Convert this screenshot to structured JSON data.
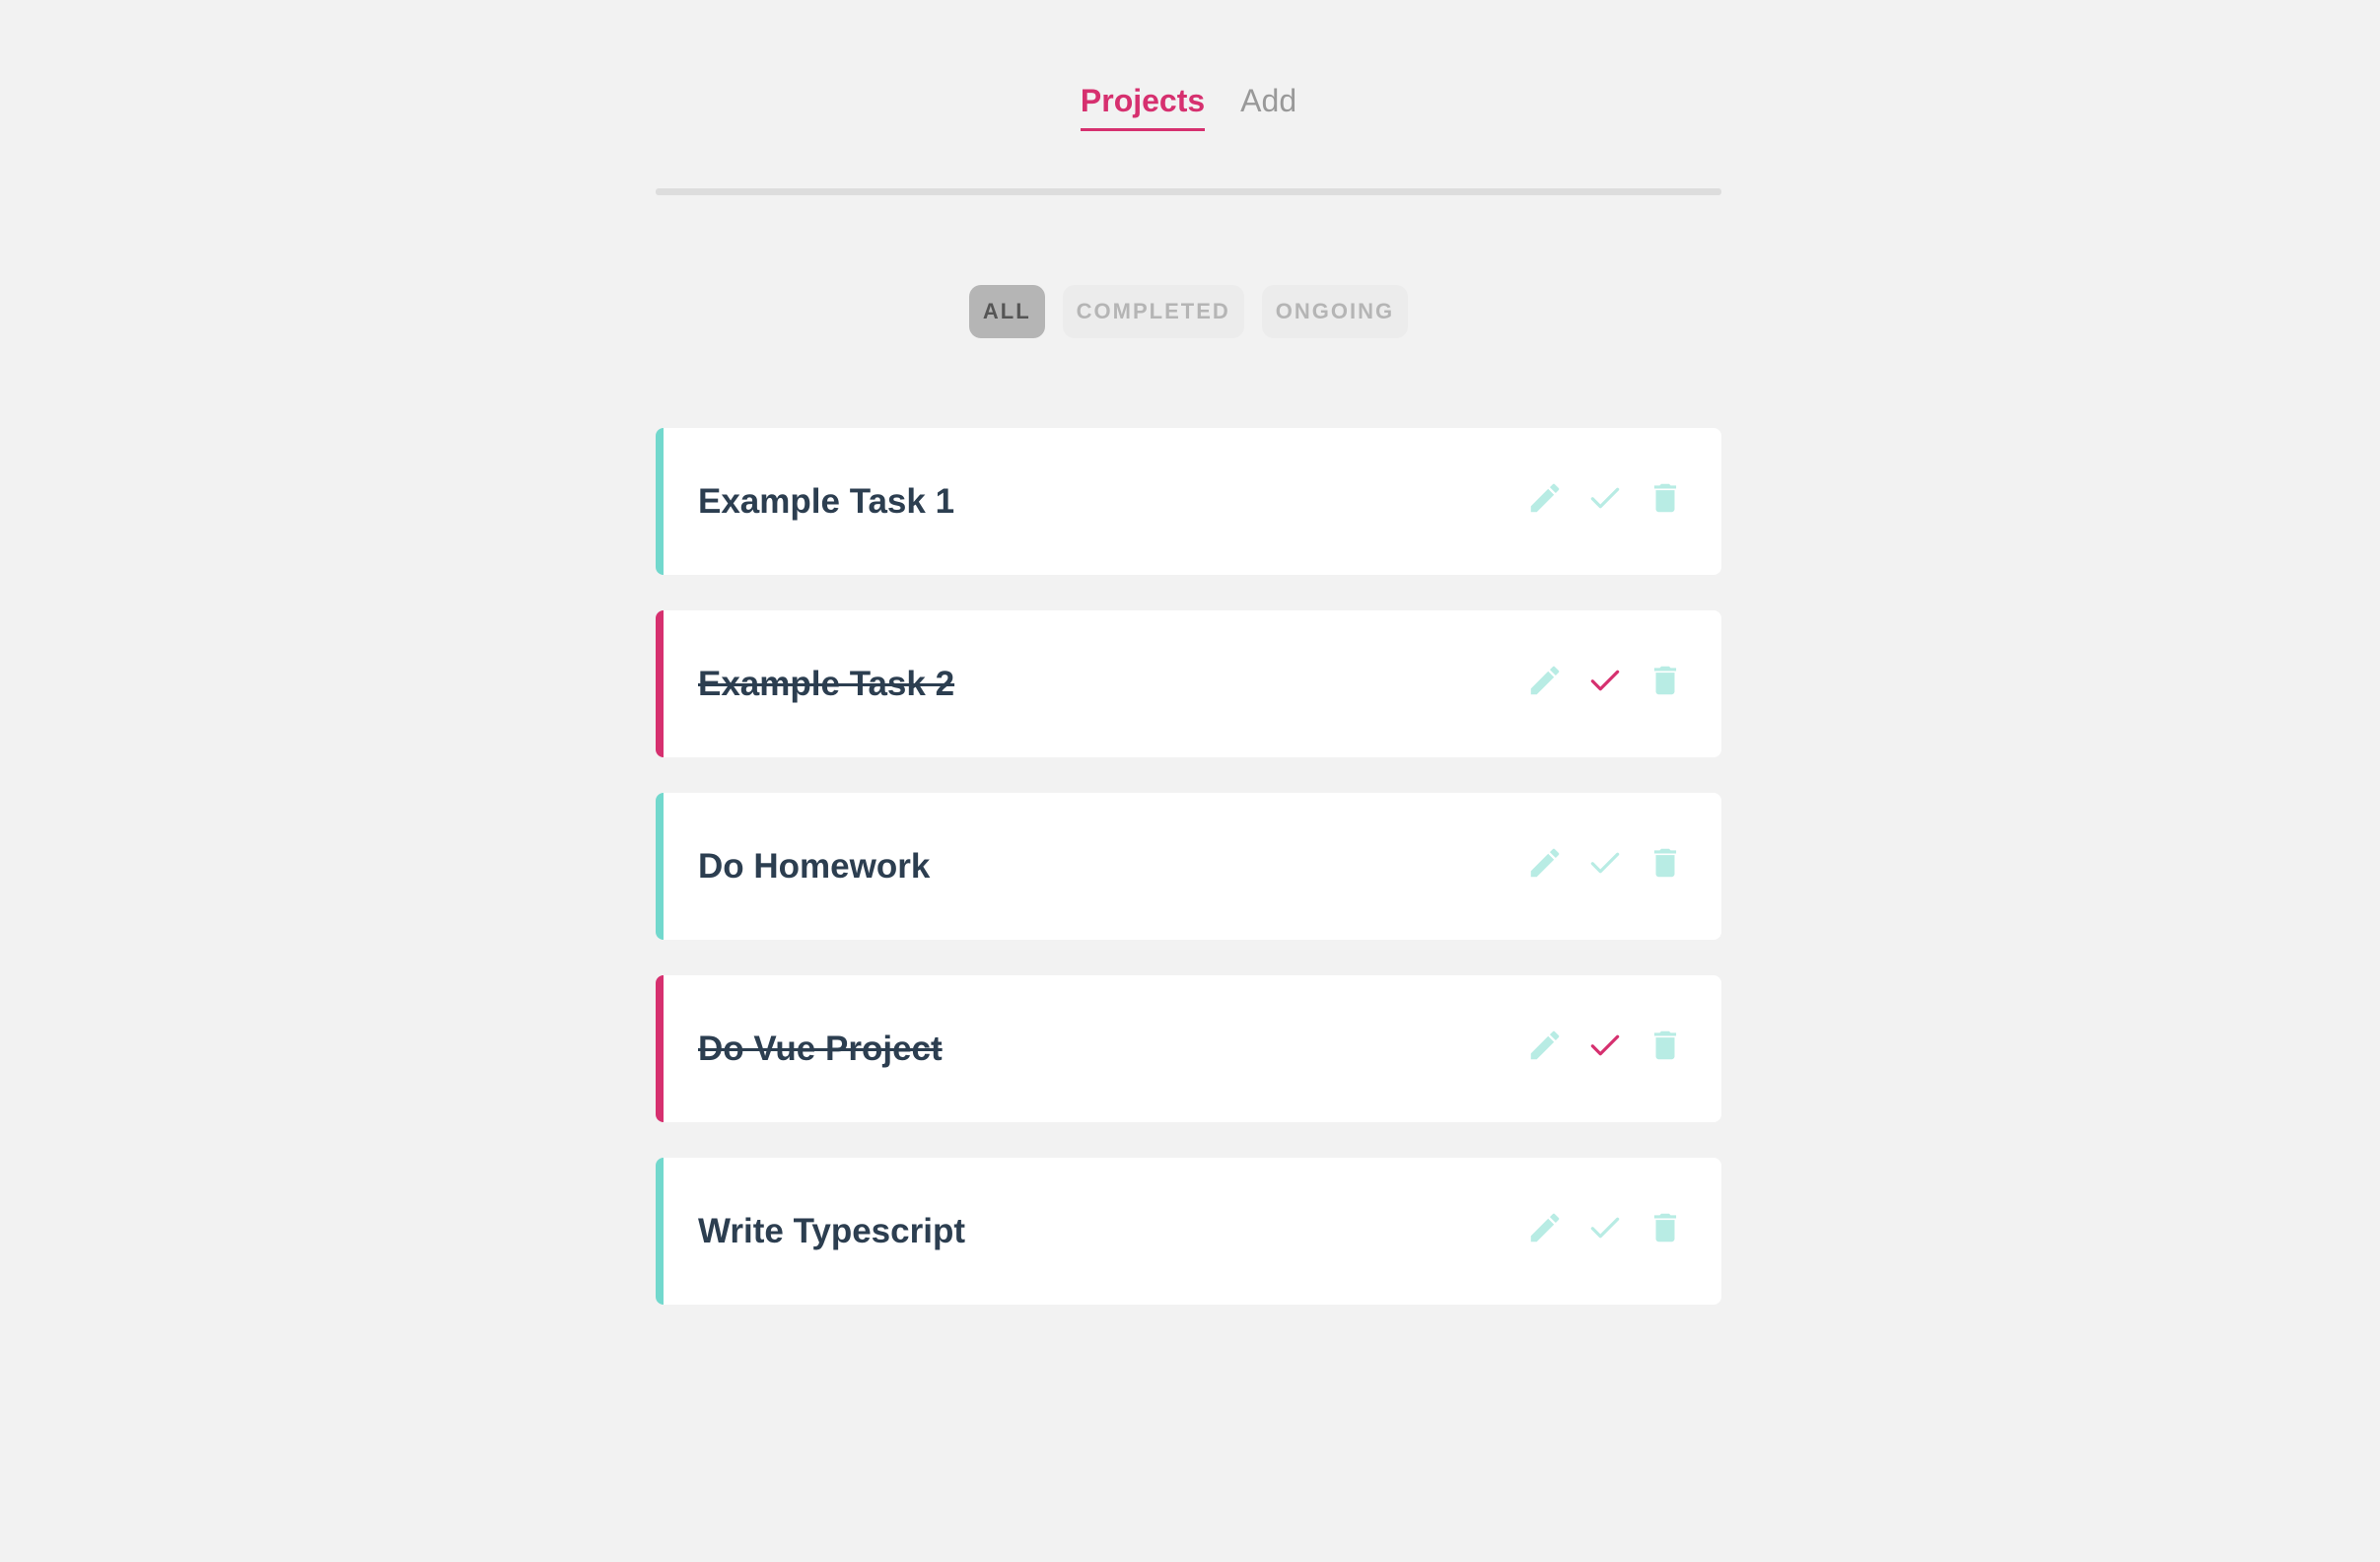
{
  "nav": {
    "items": [
      {
        "label": "Projects",
        "active": true
      },
      {
        "label": "Add",
        "active": false
      }
    ]
  },
  "filters": {
    "items": [
      {
        "label": "ALL",
        "active": true
      },
      {
        "label": "COMPLETED",
        "active": false
      },
      {
        "label": "ONGOING",
        "active": false
      }
    ]
  },
  "tasks": [
    {
      "title": "Example Task 1",
      "completed": false
    },
    {
      "title": "Example Task 2",
      "completed": true
    },
    {
      "title": "Do Homework",
      "completed": false
    },
    {
      "title": "Do Vue Project",
      "completed": true
    },
    {
      "title": "Write Typescript",
      "completed": false
    }
  ],
  "colors": {
    "accent": "#d6306f",
    "teal": "#72d8cd",
    "teal_light": "#b8ece4",
    "text": "#2c3e50",
    "background": "#f2f2f2"
  },
  "icons": {
    "edit": "pencil-icon",
    "complete": "check-icon",
    "delete": "trash-icon"
  }
}
